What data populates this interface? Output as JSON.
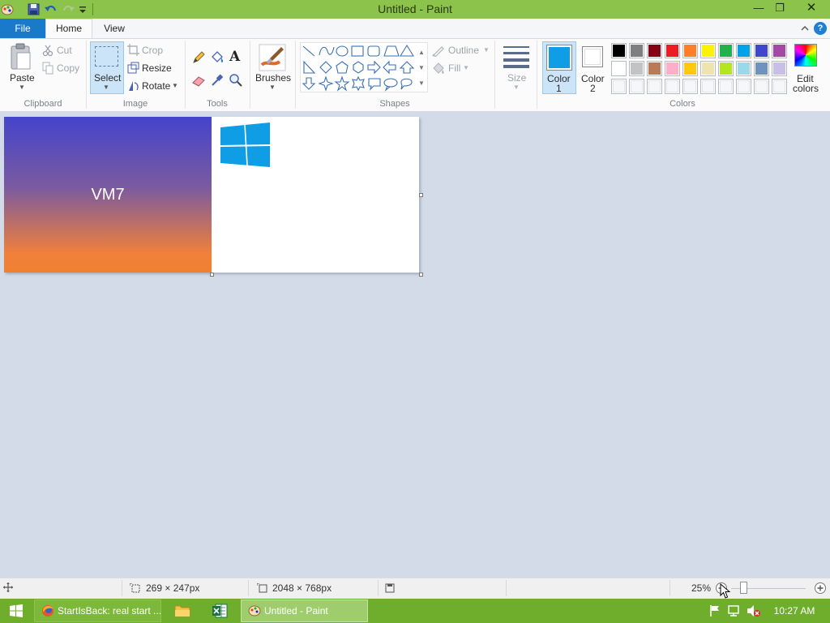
{
  "window": {
    "title": "Untitled - Paint"
  },
  "window_controls": {
    "minimize": "—",
    "restore": "❐",
    "close": "✕"
  },
  "tabs": {
    "file": "File",
    "home": "Home",
    "view": "View"
  },
  "help": "?",
  "clipboard": {
    "paste": "Paste",
    "cut": "Cut",
    "copy": "Copy",
    "group_label": "Clipboard"
  },
  "image": {
    "select": "Select",
    "crop": "Crop",
    "resize": "Resize",
    "rotate": "Rotate",
    "group_label": "Image"
  },
  "tools": {
    "group_label": "Tools",
    "text_tool": "A"
  },
  "brushes": {
    "label": "Brushes"
  },
  "shapes": {
    "outline": "Outline",
    "fill": "Fill",
    "group_label": "Shapes"
  },
  "size": {
    "label": "Size"
  },
  "colors": {
    "color1_label": "Color",
    "color1_num": "1",
    "color2_label": "Color",
    "color2_num": "2",
    "edit_label": "Edit",
    "edit_label2": "colors",
    "group_label": "Colors",
    "color1_value": "#0f9ee6",
    "color2_value": "#ffffff",
    "palette_row1": [
      "#000000",
      "#7f7f7f",
      "#880015",
      "#ed1c24",
      "#ff7f27",
      "#fff200",
      "#22b14c",
      "#00a2e8",
      "#3f48cc",
      "#a349a4"
    ],
    "palette_row2": [
      "#ffffff",
      "#c3c3c3",
      "#b97a57",
      "#ffaec9",
      "#ffc90e",
      "#efe4b0",
      "#b5e61d",
      "#99d9ea",
      "#7092be",
      "#c8bfe7"
    ]
  },
  "canvas": {
    "image_text": "VM7"
  },
  "status": {
    "selection_size": "269 × 247px",
    "image_size": "2048 × 768px",
    "zoom": "25%"
  },
  "taskbar": {
    "app1": "StartIsBack: real start ...",
    "app2": "Untitled - Paint",
    "clock": "10:27 AM"
  }
}
